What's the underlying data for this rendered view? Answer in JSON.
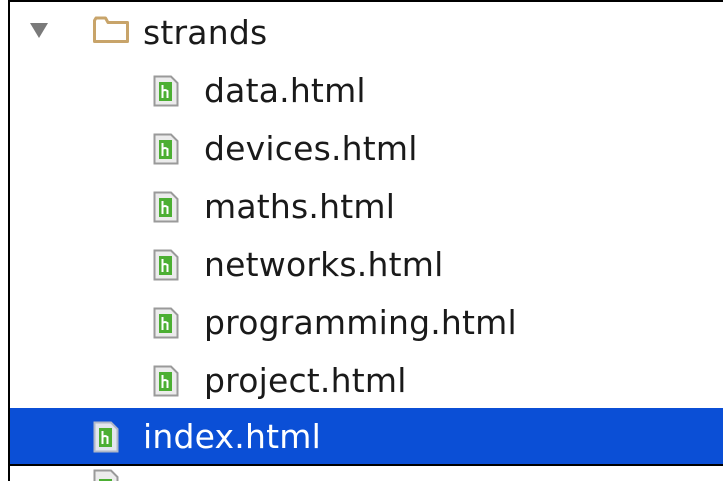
{
  "tree": {
    "folder": {
      "name": "strands",
      "expanded": true,
      "icon": "folder-icon",
      "children": [
        {
          "label": "data.html",
          "icon": "html-file-icon"
        },
        {
          "label": "devices.html",
          "icon": "html-file-icon"
        },
        {
          "label": "maths.html",
          "icon": "html-file-icon"
        },
        {
          "label": "networks.html",
          "icon": "html-file-icon"
        },
        {
          "label": "programming.html",
          "icon": "html-file-icon"
        },
        {
          "label": "project.html",
          "icon": "html-file-icon"
        }
      ]
    },
    "root_files": [
      {
        "label": "index.html",
        "icon": "html-file-icon",
        "selected": true
      }
    ]
  },
  "colors": {
    "selection": "#0b4fd6",
    "folder_outline": "#c8a46a",
    "file_icon_green": "#4caf33"
  }
}
